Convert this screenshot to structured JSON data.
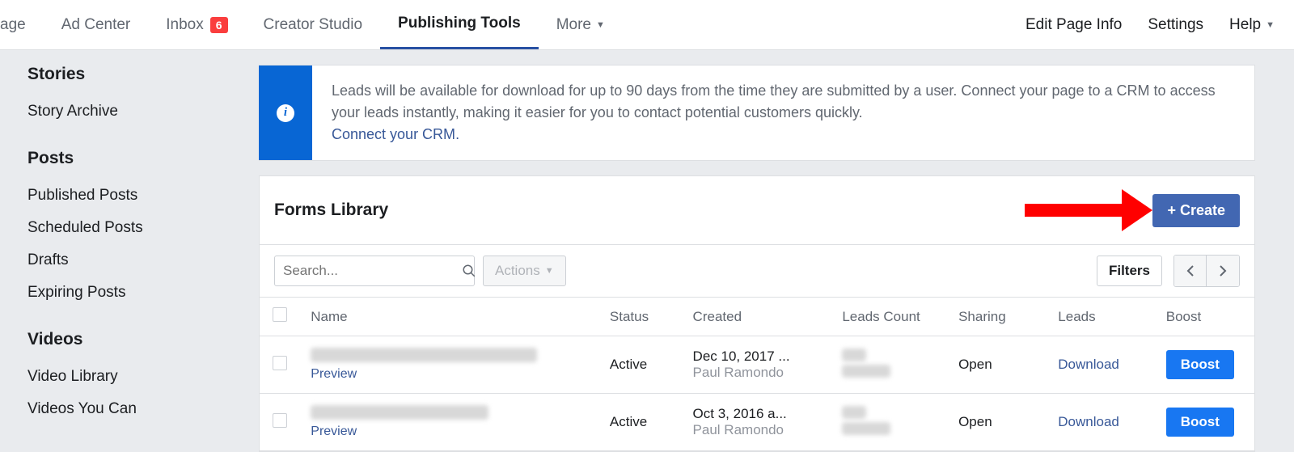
{
  "topnav": {
    "left": [
      {
        "label": "age"
      },
      {
        "label": "Ad Center"
      },
      {
        "label": "Inbox",
        "badge": "6"
      },
      {
        "label": "Creator Studio"
      },
      {
        "label": "Publishing Tools",
        "active": true
      },
      {
        "label": "More",
        "caret": true
      }
    ],
    "right": [
      {
        "label": "Edit Page Info"
      },
      {
        "label": "Settings"
      },
      {
        "label": "Help",
        "caret": true
      }
    ]
  },
  "sidebar": [
    {
      "heading": "Stories",
      "items": [
        "Story Archive"
      ]
    },
    {
      "heading": "Posts",
      "items": [
        "Published Posts",
        "Scheduled Posts",
        "Drafts",
        "Expiring Posts"
      ]
    },
    {
      "heading": "Videos",
      "items": [
        "Video Library",
        "Videos You Can"
      ]
    }
  ],
  "banner": {
    "text": "Leads will be available for download for up to 90 days from the time they are submitted by a user. Connect your page to a CRM to access your leads instantly, making it easier for you to contact potential customers quickly.",
    "link": "Connect your CRM"
  },
  "card": {
    "title": "Forms Library",
    "create_label": "+ Create",
    "search_placeholder": "Search...",
    "actions_label": "Actions",
    "filters_label": "Filters"
  },
  "table": {
    "columns": [
      "Name",
      "Status",
      "Created",
      "Leads Count",
      "Sharing",
      "Leads",
      "Boost"
    ],
    "rows": [
      {
        "preview": "Preview",
        "status": "Active",
        "created_date": "Dec 10, 2017 ...",
        "created_by": "Paul Ramondo",
        "sharing": "Open",
        "leads_link": "Download",
        "boost": "Boost"
      },
      {
        "preview": "Preview",
        "status": "Active",
        "created_date": "Oct 3, 2016 a...",
        "created_by": "Paul Ramondo",
        "sharing": "Open",
        "leads_link": "Download",
        "boost": "Boost"
      }
    ]
  }
}
